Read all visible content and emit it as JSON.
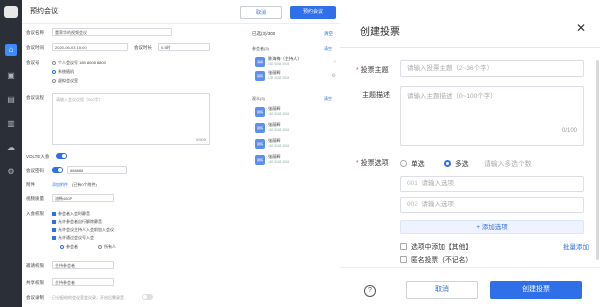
{
  "main": {
    "title": "预约会议",
    "cancel": "取消",
    "book": "预约会议"
  },
  "form": {
    "subject_label": "会议名称",
    "subject_value": "董荣华的视频会议",
    "time_label": "会议时间",
    "time_value": "2020-06-03  15:00",
    "duration_label": "会议时长",
    "duration_value": "0.5时",
    "number_label": "会议号",
    "opt_personal": "个人会议号 189 8008 8800",
    "opt_auto": "系统随机",
    "opt_free": "虚拟会议室",
    "agenda_label": "会议议程",
    "agenda_placeholder": "请输入会议议程（500字）",
    "agenda_count": "0/500",
    "voltq_label": "VOLTE入会",
    "pwd_label": "会议密码",
    "pwd_value": "888888",
    "attach_label": "附件",
    "attach_link": "添加附件",
    "attach_hint": "(已有0个附件)",
    "video_label": "视频质量",
    "video_value": "流畅480P",
    "entry_label": "入会权限",
    "entry_opts": [
      "参会者入会时静音",
      "允许参会者自行解除静音",
      "允许会议主持人入会前加入会议",
      "允许通过会议号入会"
    ],
    "entry_sub_a": "参会者",
    "entry_sub_b": "所有人",
    "notify_label": "邀请权限",
    "notify_value": "主持参会者",
    "share_label": "共享权限",
    "share_value": "主持参会者",
    "record_label": "会议录制",
    "record_value": "已分配给的会议室会议录，开启后需录音"
  },
  "participants": {
    "header": "已选(3)/300",
    "clear": "清空",
    "group1": "参会者(3)",
    "group1_clear": "清空",
    "people": [
      {
        "name": "陈海梅（主持人）",
        "sub": "182 5048 3504",
        "avatar": "海梅"
      },
      {
        "name": "张丽辉",
        "sub": "138 5048 3504",
        "avatar": "丽辉"
      }
    ],
    "group2": "观众(3)",
    "group2_clear": "清空",
    "people2": [
      {
        "name": "张丽辉",
        "sub": "182 5048 3504",
        "avatar": "丽辉"
      },
      {
        "name": "张丽辉",
        "sub": "182 5048 3504",
        "avatar": "丽辉"
      },
      {
        "name": "张丽辉",
        "sub": "182 5048 3504",
        "avatar": "丽辉"
      },
      {
        "name": "张丽辉",
        "sub": "182 5048 3504",
        "avatar": "丽辉"
      }
    ]
  },
  "modal": {
    "title": "创建投票",
    "close": "✕",
    "topic_label": "投票主题",
    "topic_placeholder": "请输入投票主题（2~36个字）",
    "desc_label": "主题描述",
    "desc_placeholder": "请输入主题描述（0~100个字）",
    "desc_count": "0/100",
    "options_label": "投票选项",
    "single": "单选",
    "multi": "多选",
    "multi_placeholder": "请输入多选个数",
    "opt1_num": "001",
    "opt1_placeholder": "请输入选项",
    "opt2_num": "002",
    "opt2_placeholder": "请输入选项",
    "add_option": "添加选项",
    "other_option": "选项中添加【其他】",
    "batch_add": "批量添加",
    "anonymous": "匿名投票（不记名）",
    "cancel": "取消",
    "create": "创建投票",
    "help": "?"
  }
}
